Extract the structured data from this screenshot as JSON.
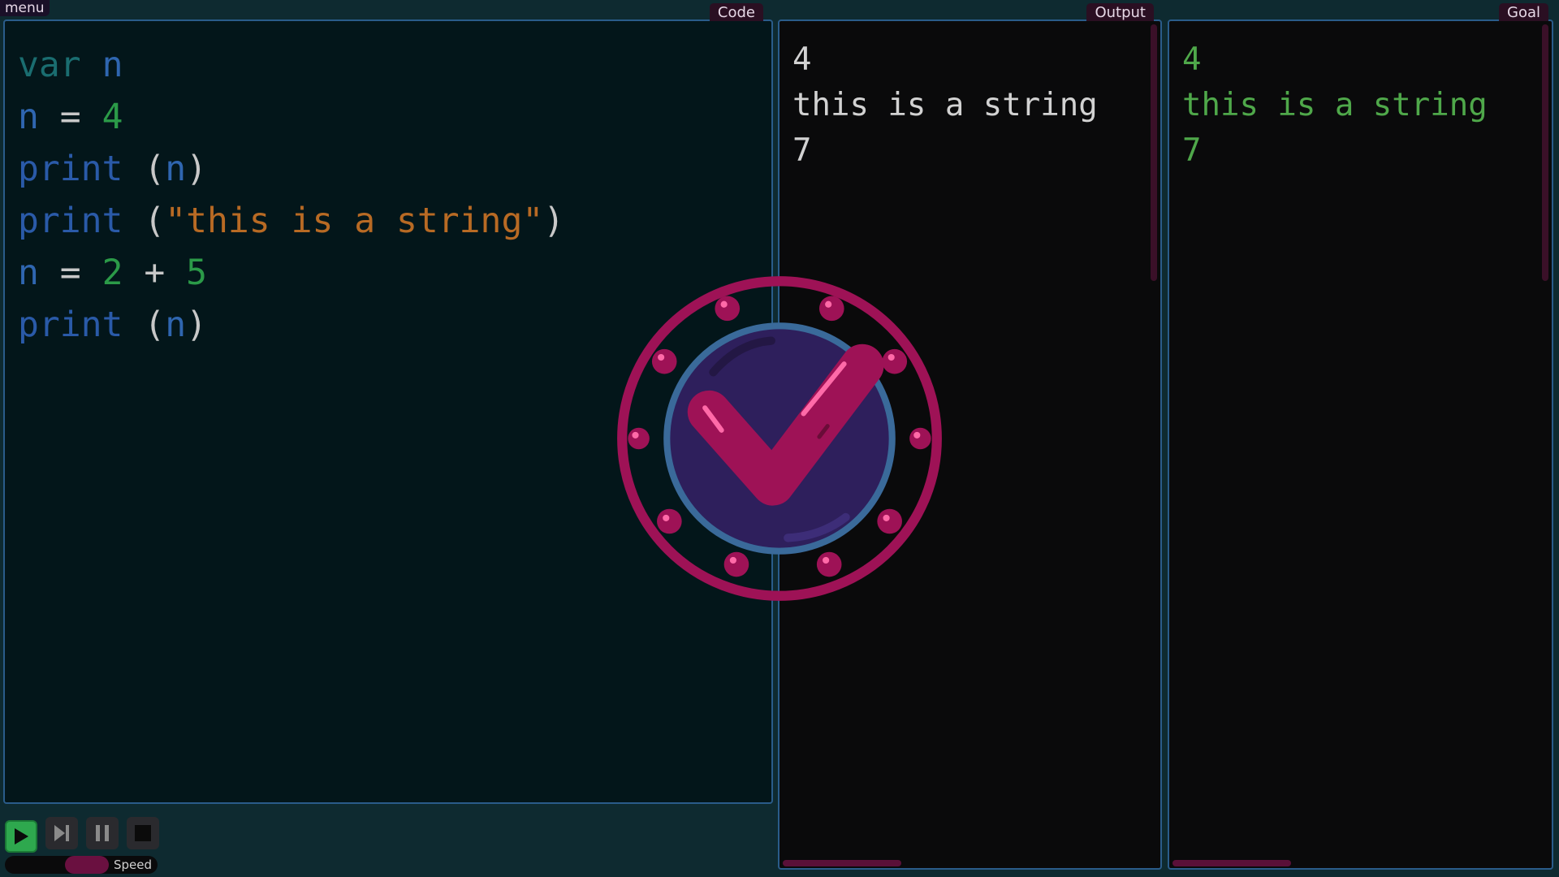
{
  "menu": {
    "label": "menu"
  },
  "code_panel": {
    "tab_label": "Code",
    "lines": [
      [
        {
          "t": "var ",
          "c": "kw-var"
        },
        {
          "t": "n",
          "c": "ident"
        }
      ],
      [
        {
          "t": "n",
          "c": "ident"
        },
        {
          "t": " = ",
          "c": "op"
        },
        {
          "t": "4",
          "c": "num"
        }
      ],
      [
        {
          "t": "print ",
          "c": "kw-print"
        },
        {
          "t": "(",
          "c": "paren"
        },
        {
          "t": "n",
          "c": "ident"
        },
        {
          "t": ")",
          "c": "paren"
        }
      ],
      [
        {
          "t": "print ",
          "c": "kw-print"
        },
        {
          "t": "(",
          "c": "paren"
        },
        {
          "t": "\"this is a string\"",
          "c": "str"
        },
        {
          "t": ")",
          "c": "paren"
        }
      ],
      [
        {
          "t": "n",
          "c": "ident"
        },
        {
          "t": " = ",
          "c": "op"
        },
        {
          "t": "2",
          "c": "num"
        },
        {
          "t": " + ",
          "c": "op"
        },
        {
          "t": "5",
          "c": "num"
        }
      ],
      [
        {
          "t": "print ",
          "c": "kw-print"
        },
        {
          "t": "(",
          "c": "paren"
        },
        {
          "t": "n",
          "c": "ident"
        },
        {
          "t": ")",
          "c": "paren"
        }
      ]
    ]
  },
  "output_panel": {
    "tab_label": "Output",
    "lines": [
      "4",
      "this is a string",
      "7"
    ]
  },
  "goal_panel": {
    "tab_label": "Goal",
    "lines": [
      "4",
      "this is a string",
      "7"
    ]
  },
  "controls": {
    "buttons": [
      {
        "name": "play-button",
        "icon": "play-icon"
      },
      {
        "name": "step-button",
        "icon": "step-forward-icon"
      },
      {
        "name": "pause-button",
        "icon": "pause-icon"
      },
      {
        "name": "stop-button",
        "icon": "stop-icon"
      }
    ],
    "speed_label": "Speed"
  },
  "overlay": {
    "icon": "success-checkmark-icon"
  },
  "colors": {
    "accent_pink": "#9e1256",
    "badge_inner": "#2e1f5c",
    "badge_ring": "#3a6a9a",
    "panel_border": "#2a5c8a",
    "play_green": "#2ea84e"
  }
}
